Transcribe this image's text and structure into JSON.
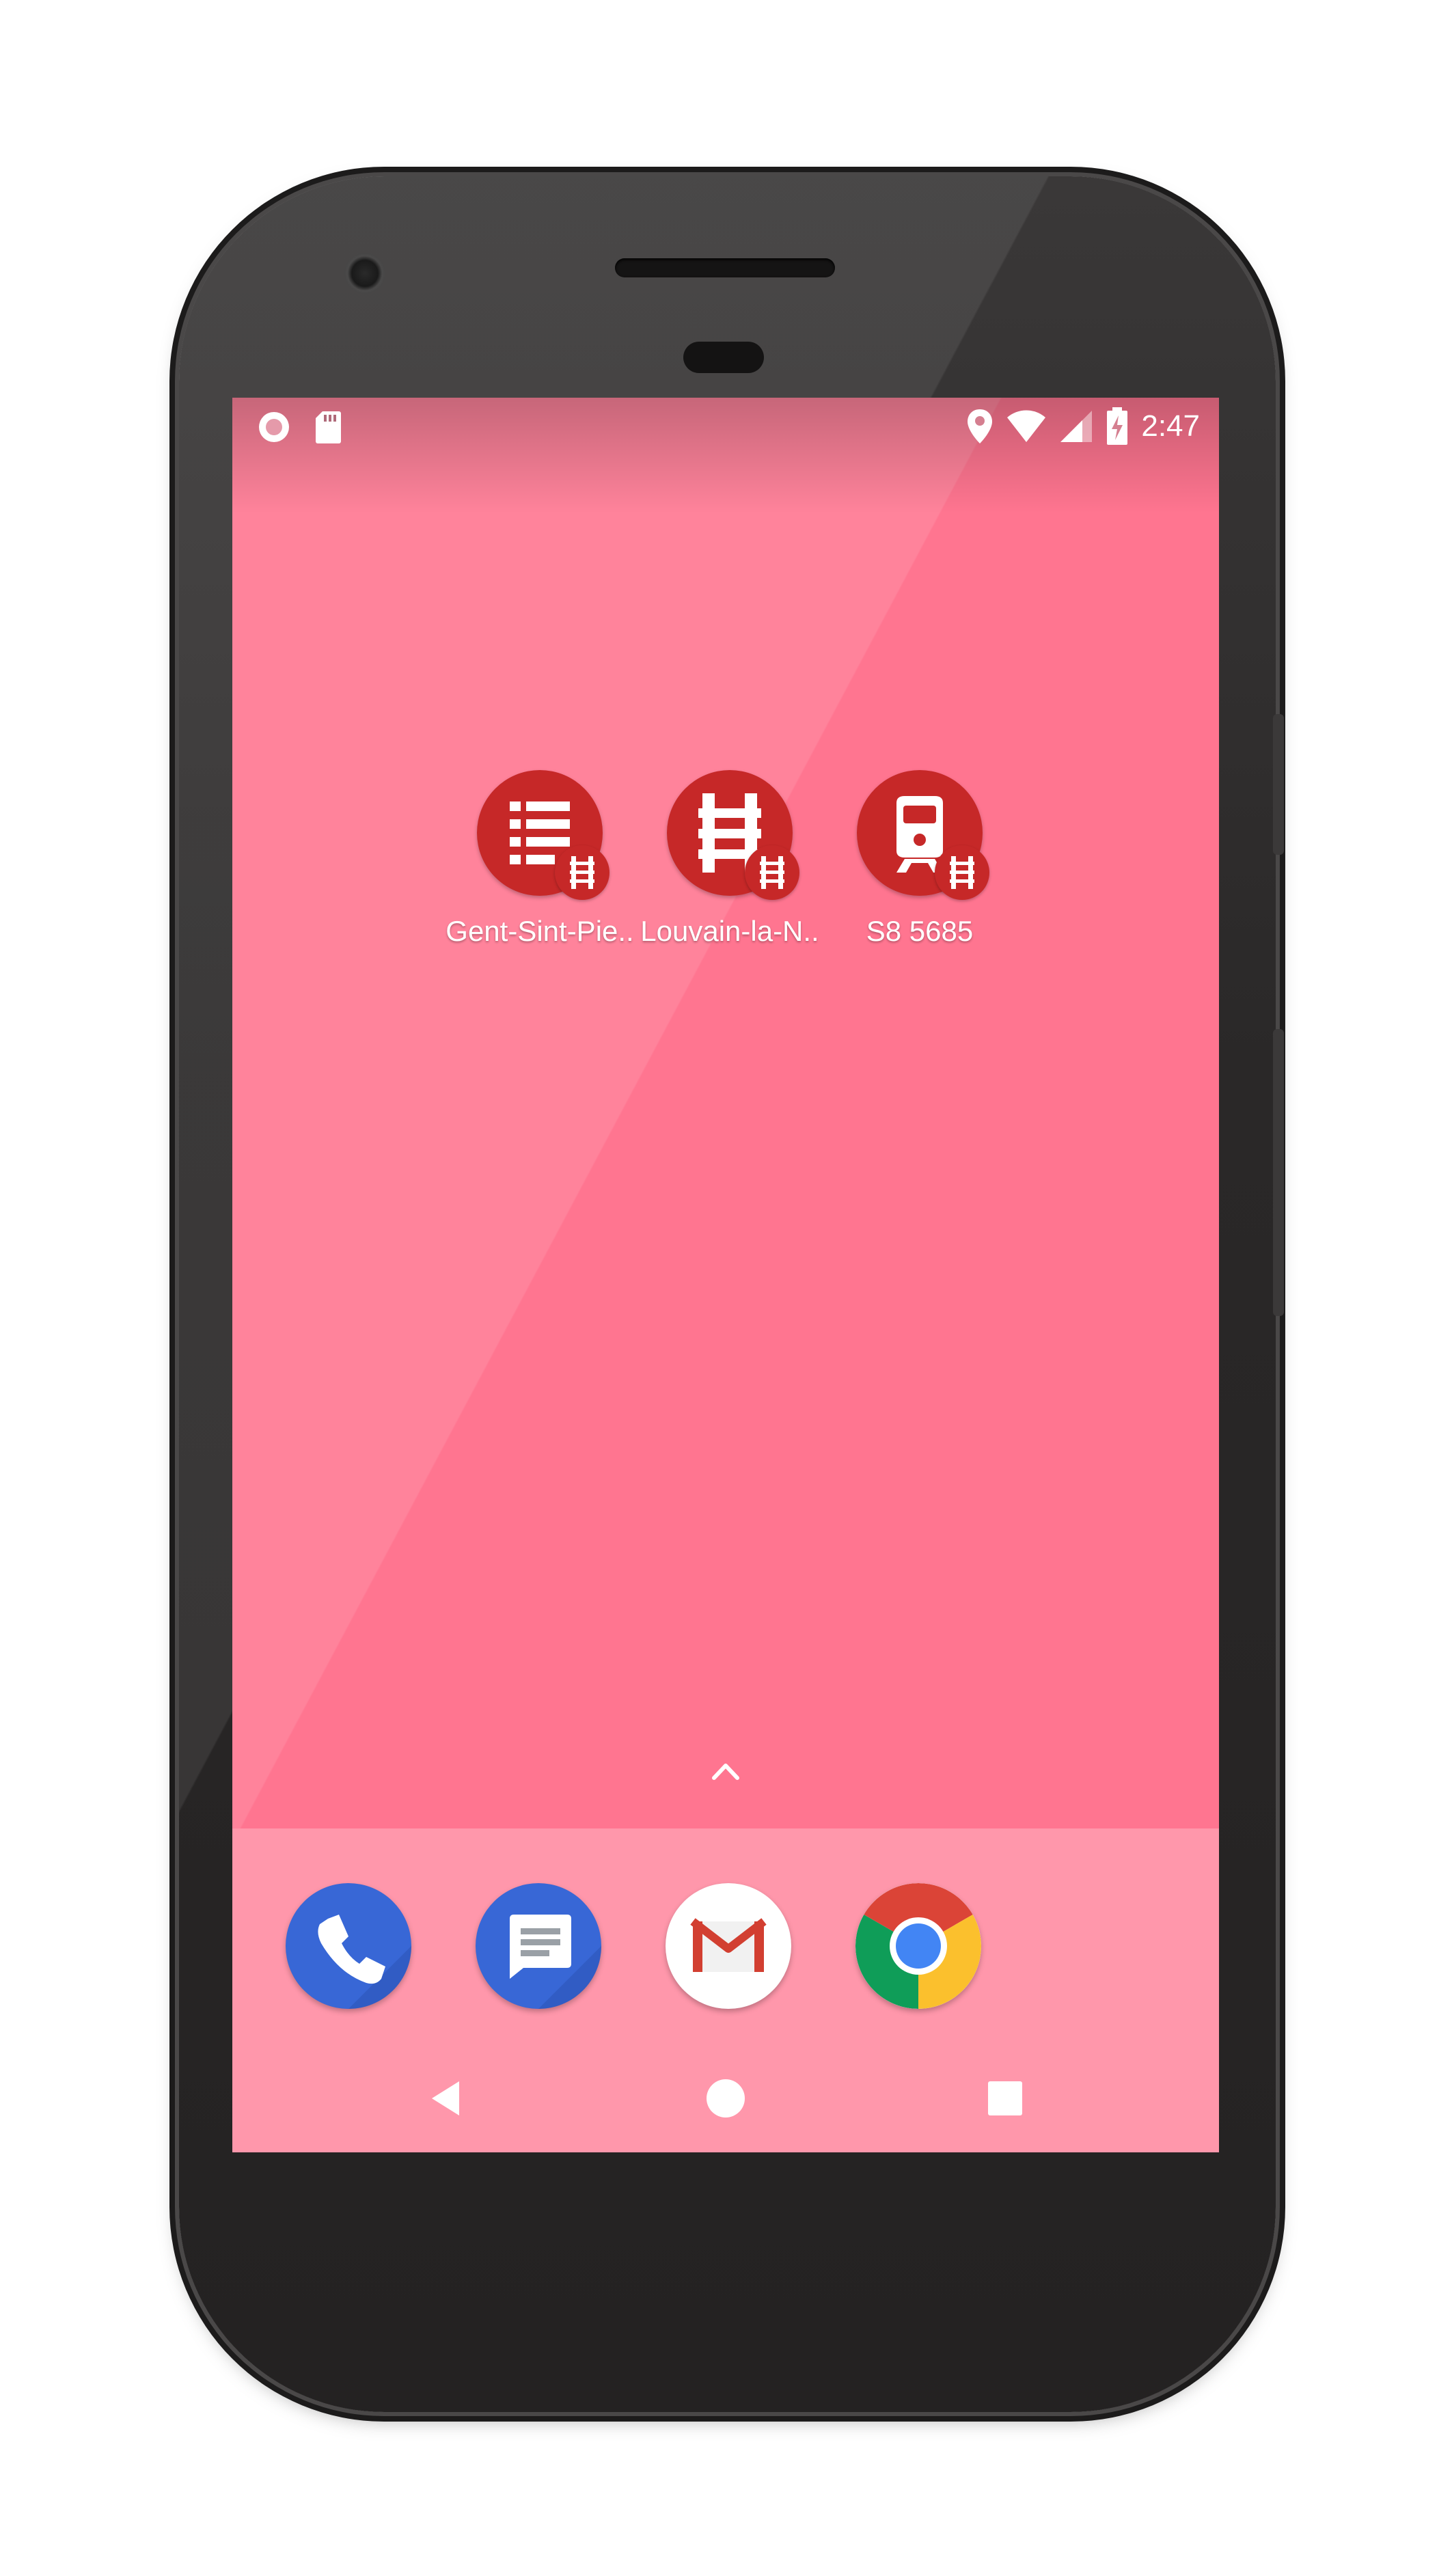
{
  "status_bar": {
    "left_icons": [
      "notification-circle-icon",
      "sd-card-icon"
    ],
    "right_icons": [
      "location-pin-icon",
      "wifi-icon",
      "cellular-signal-icon",
      "battery-charging-icon"
    ],
    "time": "2:47"
  },
  "home": {
    "shortcuts": [
      {
        "label": "Gent-Sint-Pie..",
        "icon": "departures-list-icon",
        "badge_icon": "railway-track-icon"
      },
      {
        "label": "Louvain-la-N..",
        "icon": "railway-track-icon",
        "badge_icon": "railway-track-icon"
      },
      {
        "label": "S8 5685",
        "icon": "train-icon",
        "badge_icon": "railway-track-icon"
      }
    ],
    "app_drawer_handle_icon": "chevron-up-icon"
  },
  "dock": {
    "apps": [
      {
        "name": "Phone",
        "icon": "phone-icon"
      },
      {
        "name": "Messages",
        "icon": "messages-icon"
      },
      {
        "name": "Gmail",
        "icon": "gmail-icon"
      },
      {
        "name": "Chrome",
        "icon": "chrome-icon"
      }
    ]
  },
  "nav_bar": {
    "buttons": [
      "back-icon",
      "home-icon",
      "recents-icon"
    ]
  },
  "colors": {
    "wallpaper": "#ff7590",
    "dock": "#ff97ab",
    "shortcut_red": "#c62828"
  }
}
